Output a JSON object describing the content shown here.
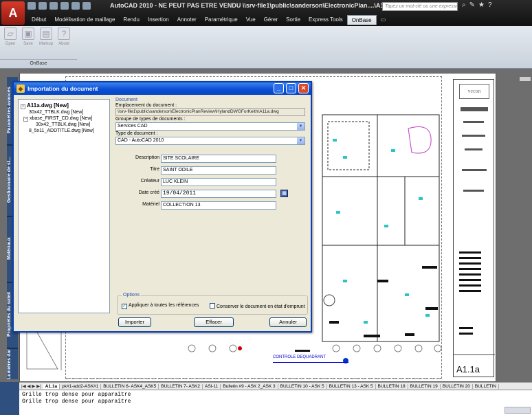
{
  "titlebar": {
    "app_letter": "A",
    "title": "AutoCAD 2010 - NE PEUT PAS ETRE VENDU   \\\\srv-file1\\public\\sanderson\\ElectronicPlan....\\A11a.dwg",
    "search_placeholder": "Tapez un mot-clé ou une expression",
    "tabs": [
      "Début",
      "Modélisation de maillage",
      "Rendu",
      "Insertion",
      "Annoter",
      "Paramétrique",
      "Vue",
      "Gérer",
      "Sortie",
      "Express Tools",
      "OnBase"
    ],
    "active_tab": "OnBase"
  },
  "ribbon": {
    "buttons": [
      "Open",
      "Save",
      "Markup",
      "About"
    ],
    "panel_label": "OnBase"
  },
  "palette": {
    "tabs": [
      "Paramètres avancés",
      "Gestionnaire de st...",
      "Matériaux",
      "Propriétés du soleil",
      "Lumières dans le ..."
    ]
  },
  "drawing": {
    "title_block_logo": "vecon",
    "sheet_id": "A1.1a",
    "plan_label": "CONTROLE DEQUADRANT"
  },
  "dialog": {
    "title": "Importation du document",
    "tree": {
      "root": "A11a.dwg [New]",
      "children": [
        "30x42_TTBLK.dwg [New]",
        "xbase_FIRST_CD.dwg [New]",
        "30x42_TTBLK.dwg [New]",
        "8_5x11_ADDTITLE.dwg [New]"
      ]
    },
    "section_title": "Document",
    "location_label": "Emplacement du document :",
    "location_value": "\\\\srv-file1\\public\\sanderson\\ElectronicPlanReview\\HylandDWGForKeith\\A11a.dwg",
    "group_label": "Groupe de types de documents :",
    "group_value": "Services CAD",
    "type_label": "Type de document :",
    "type_value": "CAD - AutoCAD 2010",
    "fields": {
      "description_label": "Description",
      "description_value": "SITE SCOLAIRE",
      "title_label": "Titre",
      "title_value": "SAINT ODILE",
      "creator_label": "Créateur",
      "creator_value": "LUC KLEIN",
      "date_label": "Date créé",
      "date_value": "19/04/2011",
      "material_label": "Matériel",
      "material_value": "COLLECTION 13"
    },
    "options_legend": "Options",
    "opt_apply_label": "Appliquer à toutes les références",
    "opt_apply_checked": true,
    "opt_keep_label": "Conserver le document en état d'emprunt",
    "opt_keep_checked": false,
    "btn_import": "Importer",
    "btn_clear": "Effacer",
    "btn_cancel": "Annuler"
  },
  "layout_tabs": [
    "A1.1a",
    "pk#1-add2-ASK#1",
    "BULLETIN 6- ASK4_ASK5",
    "BULLETIN 7- ASK2",
    "ASI-11",
    "Bulletin #9 - ASK 2_ASK 3",
    "BULLETIN 10 - ASK 5",
    "BULLETIN 13 - ASK 5",
    "BULLETIN 18",
    "BULLETIN 19",
    "BULLETIN 20",
    "BULLETIN"
  ],
  "command_line": [
    "Grille trop dense pour apparaître",
    "Grille trop dense pour apparaître"
  ]
}
